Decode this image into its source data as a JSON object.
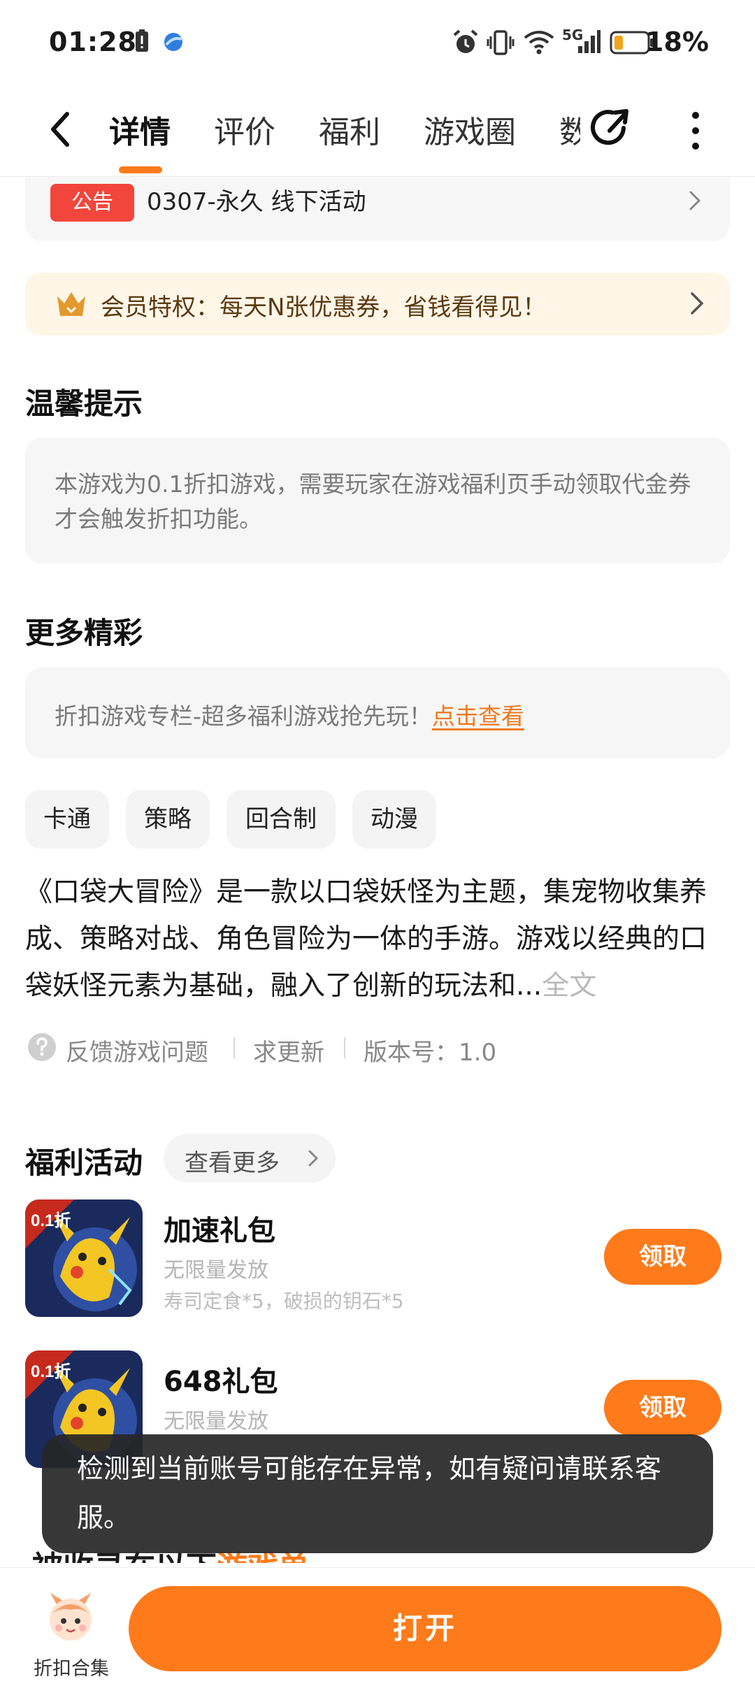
{
  "status_bar": {
    "time": "01:28",
    "battery": "18%",
    "network": "5G"
  },
  "nav": {
    "tabs": [
      {
        "label": "详情",
        "active": true
      },
      {
        "label": "评价"
      },
      {
        "label": "福利"
      },
      {
        "label": "游戏圈"
      },
      {
        "label": "数"
      }
    ]
  },
  "notice": {
    "badge": "公告",
    "text": "0307-永久  线下活动"
  },
  "member": {
    "text": "会员特权：每天N张优惠券，省钱看得见！"
  },
  "tips": {
    "title": "温馨提示",
    "text": "本游戏为0.1折扣游戏，需要玩家在游戏福利页手动领取代金券才会触发折扣功能。"
  },
  "more": {
    "title": "更多精彩",
    "text": "折扣游戏专栏-超多福利游戏抢先玩！",
    "link": "点击查看"
  },
  "tags": [
    "卡通",
    "策略",
    "回合制",
    "动漫"
  ],
  "description": {
    "text": "《口袋大冒险》是一款以口袋妖怪为主题，集宠物收集养成、策略对战、角色冒险为一体的手游。游戏以经典的口袋妖怪元素为基础，融入了创新的玩法和...",
    "more": "全文"
  },
  "links": {
    "feedback": "反馈游戏问题",
    "update": "求更新",
    "version": "版本号：1.0"
  },
  "welfare": {
    "title": "福利活动",
    "more": "查看更多",
    "gifts": [
      {
        "name": "加速礼包",
        "sub": "无限量发放",
        "items": "寿司定食*5，破损的钥石*5",
        "button": "领取",
        "badge": "0.1折"
      },
      {
        "name": "648礼包",
        "sub": "无限量发放",
        "items": "",
        "button": "领取",
        "badge": "0.1折"
      }
    ]
  },
  "partial_section": {
    "prefix": "被收录在以下",
    "highlight": "游戏单"
  },
  "toast": {
    "text": "检测到当前账号可能存在异常，如有疑问请联系客服。"
  },
  "bottom": {
    "label": "折扣合集",
    "open": "打开"
  },
  "colors": {
    "accent": "#ff7a1a",
    "notice_badge": "#f2463c",
    "member_bg": "#fff6e8"
  }
}
